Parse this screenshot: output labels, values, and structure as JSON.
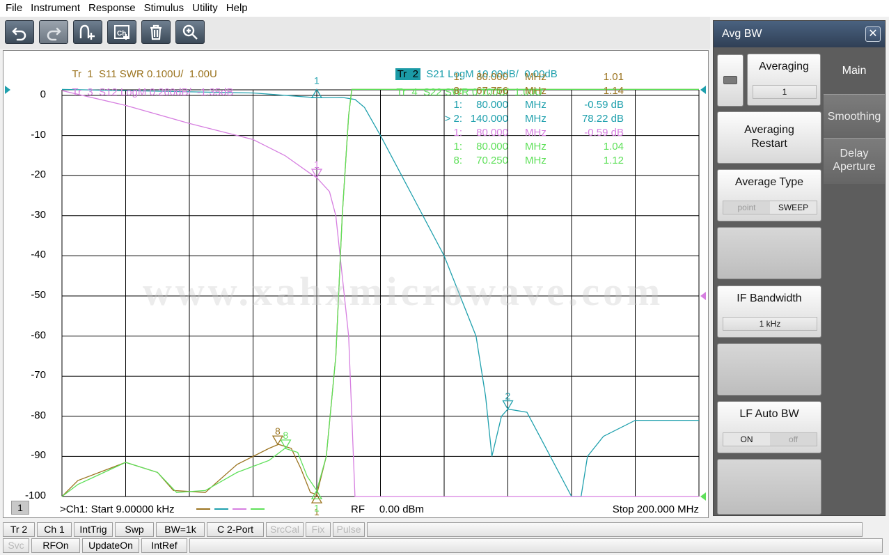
{
  "menu": [
    "File",
    "Instrument",
    "Response",
    "Stimulus",
    "Utility",
    "Help"
  ],
  "toolbar": [
    {
      "name": "undo-button",
      "icon": "undo-icon"
    },
    {
      "name": "redo-button",
      "icon": "redo-icon"
    },
    {
      "name": "add-marker-button",
      "icon": "marker-add-icon"
    },
    {
      "name": "add-channel-button",
      "icon": "channel-add-icon"
    },
    {
      "name": "delete-button",
      "icon": "trash-icon"
    },
    {
      "name": "zoom-button",
      "icon": "zoom-in-icon"
    }
  ],
  "traces": {
    "tr1": {
      "id": "Tr  1",
      "desc": "S11 SWR 0.100U/  1.00U",
      "color": "#9b7420"
    },
    "tr2": {
      "id": "Tr  2",
      "desc": "S21 LogM 10.00dB/  0.00dB",
      "color": "#1fa0ad"
    },
    "tr3": {
      "id": "Tr  3",
      "desc": "S12 LogM 0.260dB/  -1.35dB",
      "color": "#d67ee0"
    },
    "tr4": {
      "id": "Tr  4",
      "desc": "S22 SWR 0.100U/  1.00U",
      "color": "#5fe05a"
    }
  },
  "watermark": "www.xahxmicrowave.com",
  "markers": [
    {
      "num": "1:",
      "freq": "80.000",
      "unit": "MHz",
      "value": "1.01",
      "color": "#9b7420"
    },
    {
      "num": "8:",
      "freq": "67.756",
      "unit": "MHz",
      "value": "1.14",
      "color": "#9b7420"
    },
    {
      "num": "1:",
      "freq": "80.000",
      "unit": "MHz",
      "value": "-0.59 dB",
      "color": "#1fa0ad"
    },
    {
      "num": "> 2:",
      "freq": "140.000",
      "unit": "MHz",
      "value": "78.22 dB",
      "color": "#1fa0ad"
    },
    {
      "num": "1:",
      "freq": "80.000",
      "unit": "MHz",
      "value": "-0.59 dB",
      "color": "#d67ee0"
    },
    {
      "num": "1:",
      "freq": "80.000",
      "unit": "MHz",
      "value": "1.04",
      "color": "#5fe05a"
    },
    {
      "num": "8:",
      "freq": "70.250",
      "unit": "MHz",
      "value": "1.12",
      "color": "#5fe05a"
    }
  ],
  "axis": {
    "channel": "1",
    "start_label": ">Ch1:  Start  9.00000 kHz",
    "power_label": "RF     0.00 dBm",
    "stop_label": "Stop  200.000 MHz"
  },
  "chart_data": {
    "type": "line",
    "x_unit": "MHz",
    "xlim": [
      0.009,
      200
    ],
    "ylim": [
      -100,
      0
    ],
    "ytick_labels": [
      "0",
      "-10",
      "-20",
      "-30",
      "-40",
      "-50",
      "-60",
      "-70",
      "-80",
      "-90",
      "-100"
    ],
    "grid": true,
    "series": [
      {
        "name": "S11 SWR",
        "color": "#9b7420",
        "x": [
          0,
          5,
          20,
          30,
          35,
          45,
          55,
          65,
          68,
          72,
          75,
          78,
          80,
          83,
          86,
          88,
          90,
          91,
          200
        ],
        "y": [
          -100,
          -96,
          -91.5,
          -94,
          -98.5,
          -99,
          -92,
          -88,
          -87,
          -88,
          -93,
          -99,
          -99.5,
          -90,
          -65,
          -30,
          -5,
          1.5,
          1.5
        ]
      },
      {
        "name": "S21 LogM",
        "color": "#1fa0ad",
        "x": [
          0,
          60,
          80,
          88,
          92,
          95,
          100,
          110,
          120,
          130,
          133,
          135,
          138,
          140,
          146,
          150,
          160,
          163,
          165,
          170,
          180,
          200
        ],
        "y": [
          1.5,
          0.6,
          -0.59,
          -0.5,
          -1,
          -3,
          -10,
          -25,
          -40,
          -60,
          -75,
          -90,
          -80,
          -78.22,
          -79,
          -85,
          -100,
          -100,
          -90,
          -85,
          -81,
          -81
        ]
      },
      {
        "name": "S12 LogM",
        "color": "#d67ee0",
        "x": [
          0,
          20,
          40,
          60,
          70,
          78,
          80,
          84,
          86,
          88,
          90,
          92,
          93,
          200
        ],
        "y": [
          1.2,
          -2.5,
          -7,
          -11,
          -15,
          -19.5,
          -20.5,
          -24,
          -30,
          -45,
          -60,
          -100,
          -100,
          -100
        ]
      },
      {
        "name": "S22 SWR",
        "color": "#5fe05a",
        "x": [
          0,
          5,
          20,
          30,
          36,
          45,
          55,
          65,
          70,
          74,
          77,
          80,
          83,
          86,
          88,
          90,
          91,
          200
        ],
        "y": [
          -100,
          -97,
          -91.5,
          -94,
          -99,
          -98.5,
          -94,
          -91,
          -88,
          -89,
          -95,
          -98.5,
          -90,
          -65,
          -30,
          -5,
          1.5,
          1.5
        ]
      }
    ]
  },
  "panel": {
    "title": "Avg BW",
    "close": "✕",
    "softkeys": [
      {
        "name": "averaging-softkey",
        "label": "Averaging",
        "value": "1"
      },
      {
        "name": "averaging-restart-softkey",
        "label": "Averaging\nRestart"
      },
      {
        "name": "average-type-softkey",
        "label": "Average Type",
        "toggle": [
          "point",
          "SWEEP"
        ],
        "active": 1
      },
      {
        "name": "empty-softkey-1",
        "label": ""
      },
      {
        "name": "if-bandwidth-softkey",
        "label": "IF Bandwidth",
        "value": "1 kHz"
      },
      {
        "name": "empty-softkey-2",
        "label": ""
      },
      {
        "name": "lf-auto-bw-softkey",
        "label": "LF Auto BW",
        "toggle": [
          "ON",
          "off"
        ],
        "active": 0
      },
      {
        "name": "empty-softkey-3",
        "label": ""
      }
    ],
    "tabs": [
      "Main",
      "Smoothing",
      "Delay\nAperture"
    ]
  },
  "status1": [
    {
      "label": "Tr 2",
      "w": 46,
      "disabled": false
    },
    {
      "label": "Ch 1",
      "w": 50,
      "disabled": false
    },
    {
      "label": "IntTrig",
      "w": 56,
      "disabled": false
    },
    {
      "label": "Swp",
      "w": 56,
      "disabled": false
    },
    {
      "label": "BW=1k",
      "w": 70,
      "disabled": false
    },
    {
      "label": "C  2-Port",
      "w": 82,
      "disabled": false
    },
    {
      "label": "SrcCal",
      "w": 54,
      "disabled": true
    },
    {
      "label": "Fix",
      "w": 36,
      "disabled": true
    },
    {
      "label": "Pulse",
      "w": 46,
      "disabled": true
    }
  ],
  "status2": [
    {
      "label": "Svc",
      "w": 38,
      "disabled": true
    },
    {
      "label": "RFOn",
      "w": 70,
      "disabled": false
    },
    {
      "label": "UpdateOn",
      "w": 82,
      "disabled": false
    },
    {
      "label": "IntRef",
      "w": 66,
      "disabled": false
    }
  ]
}
